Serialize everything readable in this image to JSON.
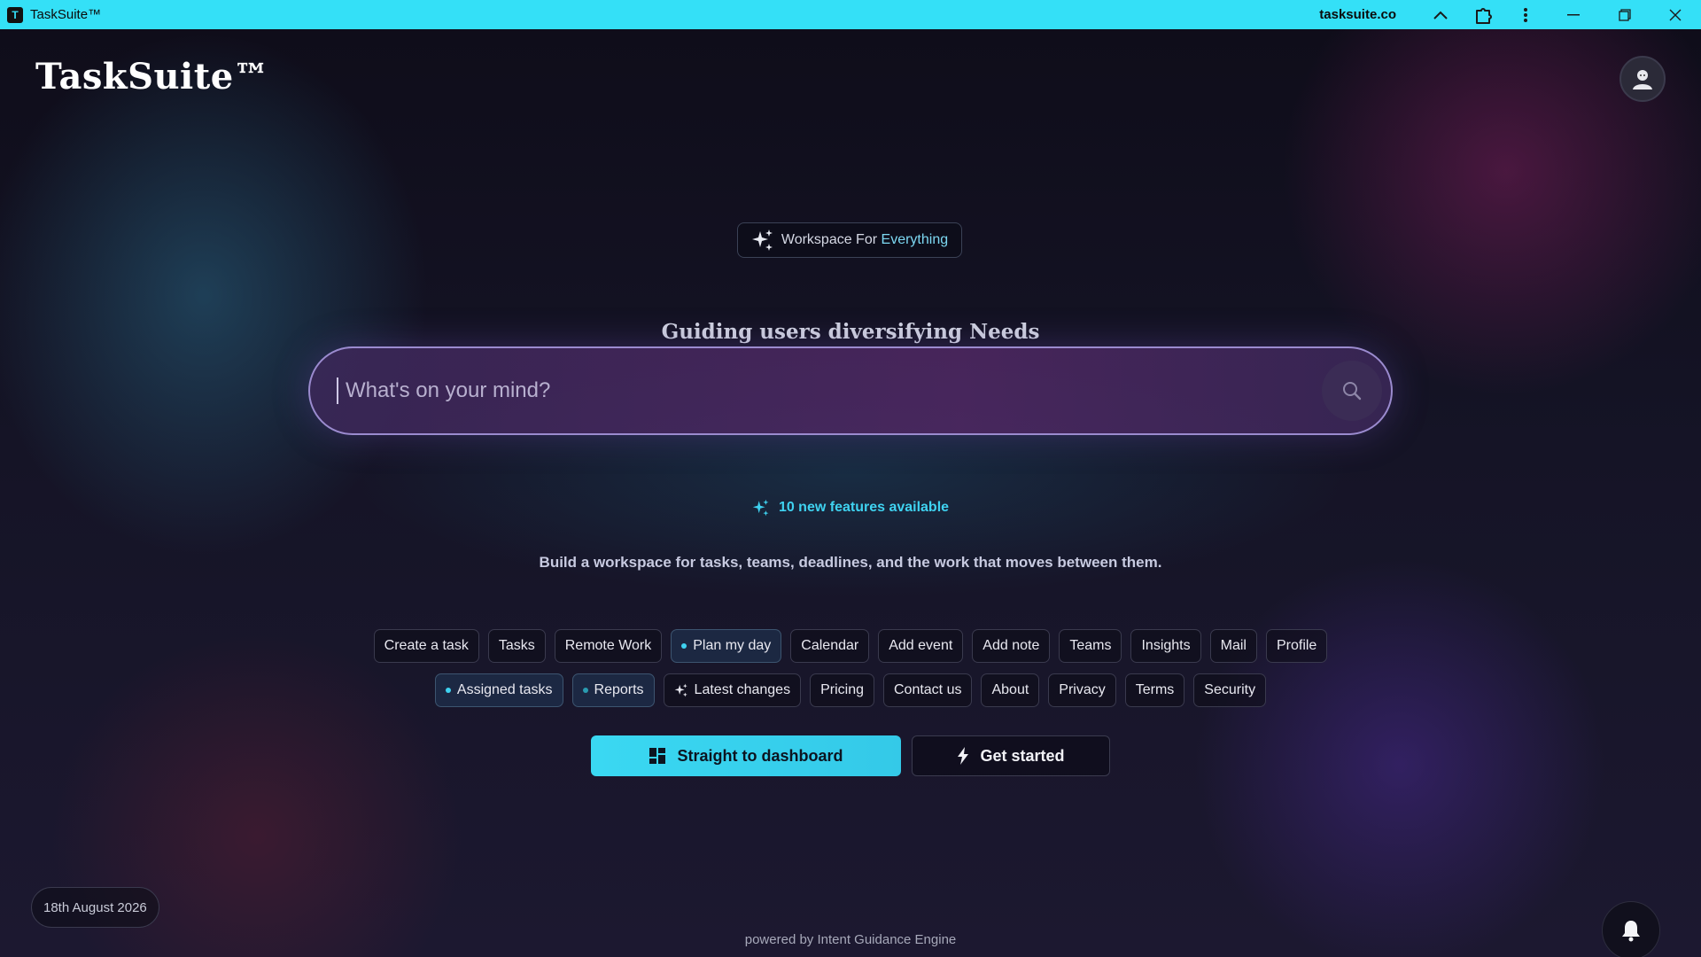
{
  "titlebar": {
    "app_icon_letter": "T",
    "title": "TaskSuite™",
    "domain": "tasksuite.co",
    "icons": [
      "chevron-up-icon",
      "extension-icon",
      "more-vertical-icon",
      "minimize-icon",
      "restore-icon",
      "close-icon"
    ]
  },
  "header": {
    "logo": "TaskSuite™",
    "avatar_icon": "avatar-icon"
  },
  "hero": {
    "badge_prefix": "Workspace For",
    "badge_accent": "Everything",
    "subtitle": "Guiding users diversifying Needs",
    "search_placeholder": "What's on your mind?",
    "features_text": "10 new features available",
    "description": "Build a workspace for tasks, teams, deadlines, and the work that moves between them."
  },
  "chips_row1": [
    {
      "label": "Create a task"
    },
    {
      "label": "Tasks"
    },
    {
      "label": "Remote Work"
    },
    {
      "label": "Plan my day"
    },
    {
      "label": "Calendar"
    },
    {
      "label": "Add event"
    },
    {
      "label": "Add note"
    },
    {
      "label": "Teams"
    },
    {
      "label": "Insights"
    },
    {
      "label": "Mail"
    },
    {
      "label": "Profile"
    }
  ],
  "chips_row2": [
    {
      "label": "Assigned tasks"
    },
    {
      "label": "Reports"
    },
    {
      "label": "Latest changes"
    },
    {
      "label": "Pricing"
    },
    {
      "label": "Contact us"
    },
    {
      "label": "About"
    },
    {
      "label": "Privacy"
    },
    {
      "label": "Terms"
    },
    {
      "label": "Security"
    }
  ],
  "actions": {
    "primary": "Straight to dashboard",
    "secondary": "Get started"
  },
  "footer": {
    "date": "18th August 2026",
    "powered_by": "powered by Intent Guidance Engine"
  },
  "colors": {
    "titlebar": "#34e0f7",
    "accent": "#3fd2f0",
    "background": "#14101f"
  }
}
